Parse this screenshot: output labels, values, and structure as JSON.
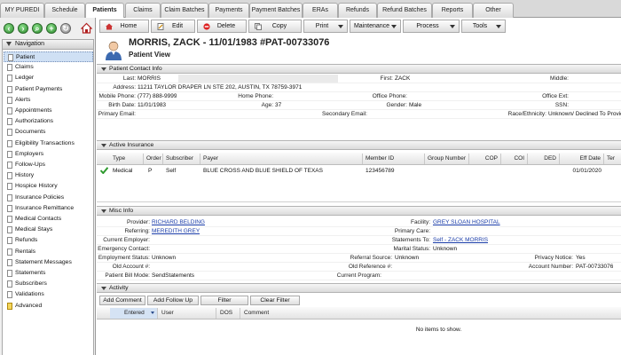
{
  "top_tabs": [
    "MY PUREDI",
    "Schedule",
    "Patients",
    "Claims",
    "Claim Batches",
    "Payments",
    "Payment Batches",
    "ERAs",
    "Refunds",
    "Refund Batches",
    "Reports",
    "Other"
  ],
  "nav": {
    "title": "Navigation",
    "items": [
      "Patient",
      "Claims",
      "Ledger",
      "Patient Payments",
      "Alerts",
      "Appointments",
      "Authorizations",
      "Documents",
      "Eligibility Transactions",
      "Employers",
      "Follow-Ups",
      "History",
      "Hospice History",
      "Insurance Policies",
      "Insurance Remittance",
      "Medical Contacts",
      "Medical Stays",
      "Refunds",
      "Rentals",
      "Statement Messages",
      "Statements",
      "Subscribers",
      "Validations",
      "Advanced"
    ]
  },
  "toolbar": {
    "home": "Home",
    "edit": "Edit",
    "delete": "Delete",
    "copy": "Copy",
    "print": "Print",
    "maintenance": "Maintenance",
    "process": "Process",
    "tools": "Tools"
  },
  "header": {
    "name": "MORRIS, ZACK - 11/01/1983 #PAT-00733076",
    "subtitle": "Patient View"
  },
  "contact": {
    "title": "Patient Contact Info",
    "last_label": "Last:",
    "last": "MORRIS",
    "first_label": "First:",
    "first": "ZACK",
    "middle_label": "Middle:",
    "middle": "",
    "address_label": "Address:",
    "address": "11211 TAYLOR DRAPER LN STE 202, AUSTIN, TX 78759-3971",
    "mobile_label": "Mobile Phone:",
    "mobile": "(777) 888-9999",
    "home_phone_label": "Home Phone:",
    "home_phone": "",
    "office_phone_label": "Office Phone:",
    "office_phone": "",
    "office_ext_label": "Office Ext:",
    "office_ext": "",
    "birth_label": "Birth Date:",
    "birth": "11/01/1983",
    "age_label": "Age:",
    "age": "37",
    "gender_label": "Gender:",
    "gender": "Male",
    "ssn_label": "SSN:",
    "ssn": "",
    "primary_email_label": "Primary Email:",
    "primary_email": "",
    "secondary_email_label": "Secondary Email:",
    "secondary_email": "",
    "race_label": "Race/Ethnicity:",
    "race": "Unknown/ Declined To Provide"
  },
  "insurance": {
    "title": "Active Insurance",
    "columns": [
      "Type",
      "Order",
      "Subscriber",
      "Payer",
      "Member ID",
      "Group Number",
      "COP",
      "COI",
      "DED",
      "Eff Date",
      "Ter"
    ],
    "row": {
      "type": "Medical",
      "order": "P",
      "subscriber": "Self",
      "payer": "BLUE CROSS AND BLUE SHIELD OF TEXAS",
      "member_id": "123456789",
      "group": "",
      "cop": "",
      "coi": "",
      "ded": "",
      "eff": "01/01/2020",
      "ter": ""
    }
  },
  "misc": {
    "title": "Misc Info",
    "provider_label": "Provider:",
    "provider": "RICHARD BELDING",
    "facility_label": "Facility:",
    "facility": "GREY SLOAN HOSPITAL",
    "referring_label": "Referring:",
    "referring": "MEREDITH GREY",
    "primary_care_label": "Primary Care:",
    "primary_care": "",
    "employer_label": "Current Employer:",
    "employer": "",
    "statements_to_label": "Statements To:",
    "statements_to": "Self - ZACK MORRIS",
    "emergency_label": "Emergency Contact:",
    "emergency": "",
    "marital_label": "Marital Status:",
    "marital": "Unknown",
    "emp_status_label": "Employment Status:",
    "emp_status": "Unknown",
    "ref_source_label": "Referral Source:",
    "ref_source": "Unknown",
    "privacy_label": "Privacy Notice:",
    "privacy": "Yes",
    "old_account_label": "Old Account #:",
    "old_account": "",
    "old_reference_label": "Old Reference #:",
    "old_reference": "",
    "account_number_label": "Account Number:",
    "account_number": "PAT-00733076",
    "bill_mode_label": "Patient Bill Mode:",
    "bill_mode": "SendStatements",
    "current_program_label": "Current Program:",
    "current_program": ""
  },
  "activity": {
    "title": "Activity",
    "buttons": {
      "add_comment": "Add Comment",
      "add_follow_up": "Add Follow Up",
      "filter": "Filter",
      "clear_filter": "Clear Filter"
    },
    "columns": [
      "Entered",
      "User",
      "DOS",
      "Comment"
    ],
    "empty": "No items to show."
  }
}
